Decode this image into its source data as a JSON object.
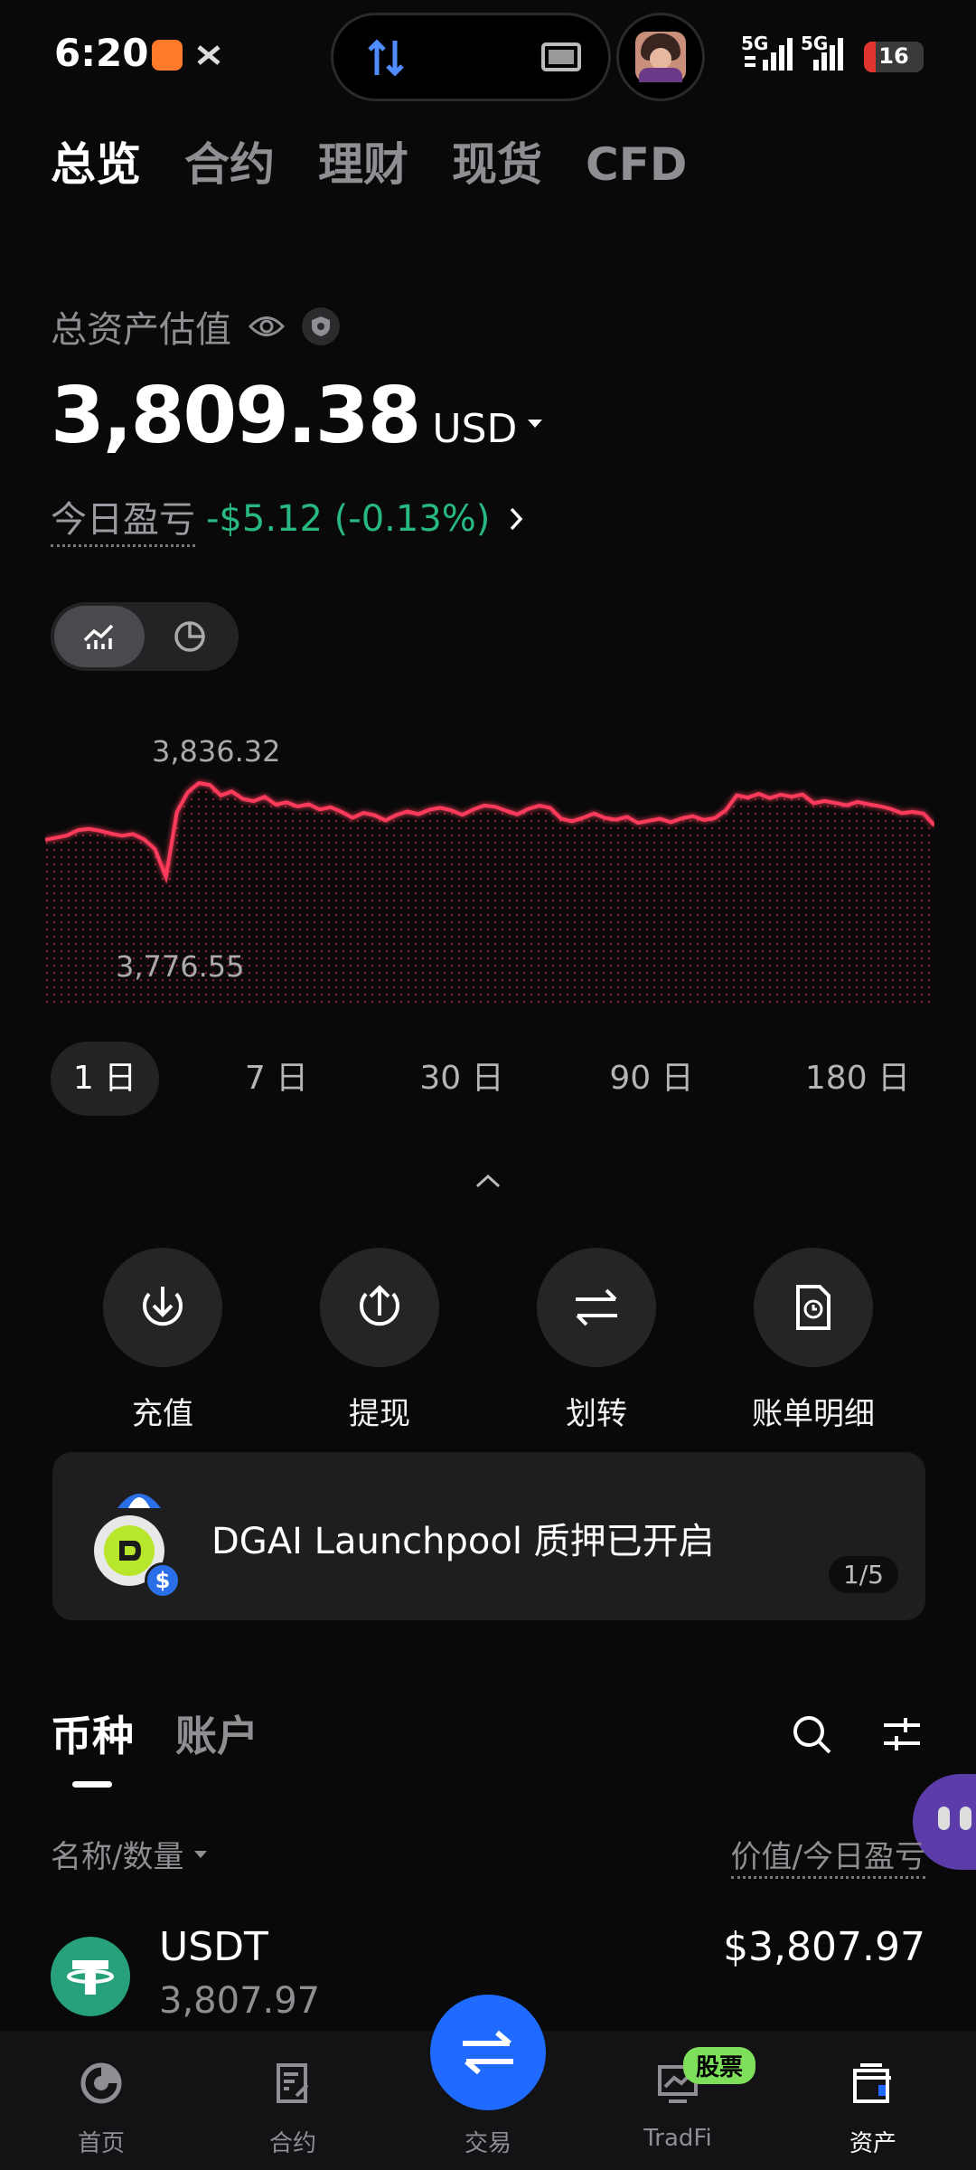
{
  "status_bar": {
    "time": "6:20",
    "signal_1": "5G",
    "signal_2": "5G",
    "battery": "16"
  },
  "top_tabs": [
    {
      "label": "总览",
      "active": true
    },
    {
      "label": "合约",
      "active": false
    },
    {
      "label": "理财",
      "active": false
    },
    {
      "label": "现货",
      "active": false
    },
    {
      "label": "CFD",
      "active": false
    }
  ],
  "summary": {
    "label": "总资产估值",
    "value": "3,809.38",
    "currency": "USD",
    "pnl_label": "今日盈亏",
    "pnl_value": "-$5.12 (-0.13%)"
  },
  "chart_data": {
    "type": "area",
    "high_label": "3,836.32",
    "low_label": "3,776.55",
    "x": [
      0,
      1,
      2,
      3,
      4,
      5,
      6,
      7,
      8,
      9,
      10,
      11,
      12,
      13,
      14,
      15,
      16,
      17,
      18,
      19,
      20,
      21,
      22,
      23,
      24,
      25,
      26,
      27,
      28,
      29,
      30,
      31,
      32,
      33,
      34,
      35,
      36,
      37,
      38,
      39,
      40,
      41,
      42,
      43,
      44,
      45,
      46,
      47,
      48,
      49,
      50,
      51,
      52,
      53,
      54,
      55,
      56,
      57,
      58,
      59,
      60,
      61,
      62,
      63,
      64,
      65,
      66,
      67,
      68,
      69,
      70,
      71,
      72,
      73,
      74,
      75,
      76,
      77,
      78,
      79,
      80,
      81,
      82,
      83,
      84,
      85,
      86,
      87,
      88,
      89,
      90,
      91,
      92,
      93,
      94,
      95,
      96,
      97,
      98,
      99,
      100
    ],
    "values": [
      3800.2,
      3801.5,
      3803.0,
      3806.4,
      3807.1,
      3806.0,
      3804.2,
      3802.8,
      3803.9,
      3800.5,
      3794.3,
      3776.55,
      3818.0,
      3830.5,
      3836.32,
      3835.1,
      3828.4,
      3830.9,
      3826.2,
      3824.8,
      3827.5,
      3822.6,
      3824.0,
      3821.3,
      3822.8,
      3819.5,
      3820.9,
      3818.0,
      3814.2,
      3817.3,
      3815.8,
      3812.5,
      3816.0,
      3818.2,
      3816.5,
      3819.3,
      3820.6,
      3818.9,
      3816.1,
      3819.5,
      3822.0,
      3821.2,
      3818.7,
      3816.4,
      3819.8,
      3821.9,
      3820.5,
      3813.6,
      3812.0,
      3814.2,
      3816.9,
      3814.1,
      3813.0,
      3814.8,
      3810.9,
      3812.3,
      3813.6,
      3811.4,
      3813.9,
      3815.2,
      3812.8,
      3814.0,
      3819.0,
      3828.5,
      3827.0,
      3829.4,
      3826.7,
      3828.9,
      3827.6,
      3829.0,
      3823.5,
      3824.9,
      3823.6,
      3822.1,
      3824.3,
      3822.8,
      3821.6,
      3819.9,
      3817.2,
      3818.0,
      3816.9,
      3809.38
    ],
    "color": "#ff3b5c",
    "ranges": [
      "1 日",
      "7 日",
      "30 日",
      "90 日",
      "180 日"
    ],
    "active_range": "1 日"
  },
  "actions": [
    {
      "label": "充值",
      "icon": "deposit-icon"
    },
    {
      "label": "提现",
      "icon": "withdraw-icon"
    },
    {
      "label": "划转",
      "icon": "transfer-icon"
    },
    {
      "label": "账单明细",
      "icon": "bill-icon"
    }
  ],
  "banner": {
    "text": "DGAI Launchpool 质押已开启",
    "pager": "1/5"
  },
  "asset_tabs": [
    {
      "label": "币种",
      "active": true
    },
    {
      "label": "账户",
      "active": false
    }
  ],
  "list_header": {
    "left": "名称/数量",
    "right": "价值/今日盈亏"
  },
  "assets": [
    {
      "name": "USDT",
      "amount": "3,807.97",
      "value": "$3,807.97"
    }
  ],
  "bottom_nav": [
    {
      "label": "首页",
      "icon": "home-icon",
      "active": false
    },
    {
      "label": "合约",
      "icon": "contract-icon",
      "active": false
    },
    {
      "label": "交易",
      "icon": "trade-icon",
      "active": false
    },
    {
      "label": "TradFi",
      "icon": "tradfi-icon",
      "active": false,
      "badge": "股票"
    },
    {
      "label": "资产",
      "icon": "wallet-icon",
      "active": true
    }
  ],
  "colors": {
    "positive": "#27b981",
    "chart_line": "#ff3b5c",
    "fab": "#1f6bff",
    "badge": "#7ee05a"
  }
}
